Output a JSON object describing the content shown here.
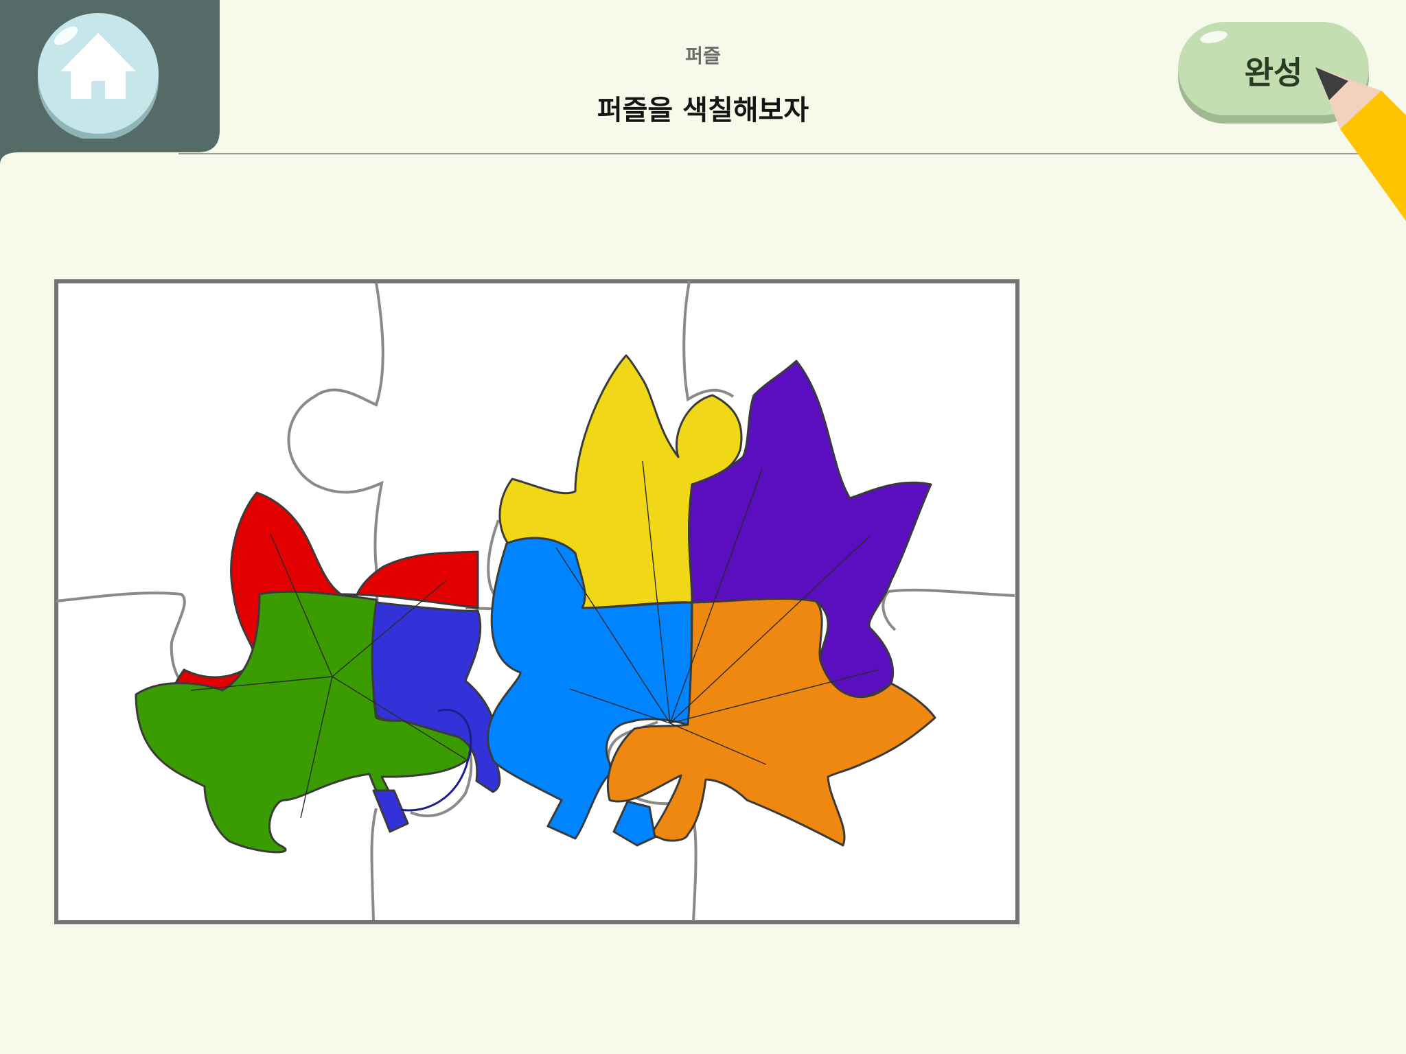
{
  "header": {
    "subtitle": "퍼즐",
    "title": "퍼즐을 색칠해보자",
    "home_icon": "home-icon",
    "done_label": "완성",
    "cursor_icon": "pencil-icon"
  },
  "colors": {
    "background": "#f7f9ea",
    "home_panel": "#546b68",
    "home_button": "#c6e6ea",
    "done_button": "#c3dfb1",
    "board_frame": "#737373",
    "piece_outline": "#8a8a8a"
  },
  "puzzle": {
    "grid": {
      "columns": 3,
      "rows": 2
    },
    "leaves": [
      {
        "name": "left-leaf",
        "segments": [
          {
            "piece": "top-left",
            "color": "#e30000"
          },
          {
            "piece": "bottom-left",
            "color": "#3a9c00"
          },
          {
            "piece": "bottom-center",
            "color": "#3232d8"
          }
        ]
      },
      {
        "name": "right-leaf",
        "segments": [
          {
            "piece": "top-center",
            "color": "#f0d818"
          },
          {
            "piece": "top-right",
            "color": "#5b0ebf"
          },
          {
            "piece": "bottom-center",
            "color": "#0084ff"
          },
          {
            "piece": "bottom-right",
            "color": "#ee8810"
          }
        ]
      }
    ]
  }
}
